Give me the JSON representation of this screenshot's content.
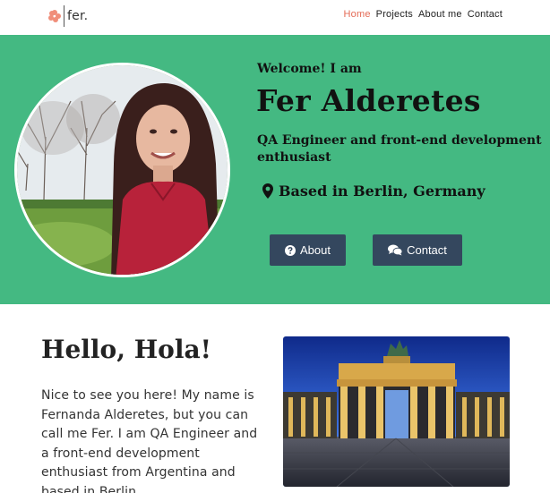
{
  "nav": {
    "logo_text": "fer.",
    "links": [
      "Home",
      "Projects",
      "About me",
      "Contact"
    ],
    "active": "Home"
  },
  "hero": {
    "welcome": "Welcome! I am",
    "name": "Fer Alderetes",
    "role": "QA Engineer and front-end development enthusiast",
    "location": "Based in Berlin, Germany",
    "about_button": "About",
    "contact_button": "Contact"
  },
  "about": {
    "heading": "Hello, Hola!",
    "intro": "Nice to see you here! My name is Fernanda Alderetes, but you can call me Fer. I am QA Engineer and a front-end development enthusiast from Argentina and based in Berlin."
  },
  "colors": {
    "hero_bg": "#44b982",
    "button_bg": "#34475e",
    "active_link": "#e46a55"
  },
  "icons": [
    "flower-logo-icon",
    "map-marker-icon",
    "question-circle-icon",
    "comments-icon"
  ]
}
